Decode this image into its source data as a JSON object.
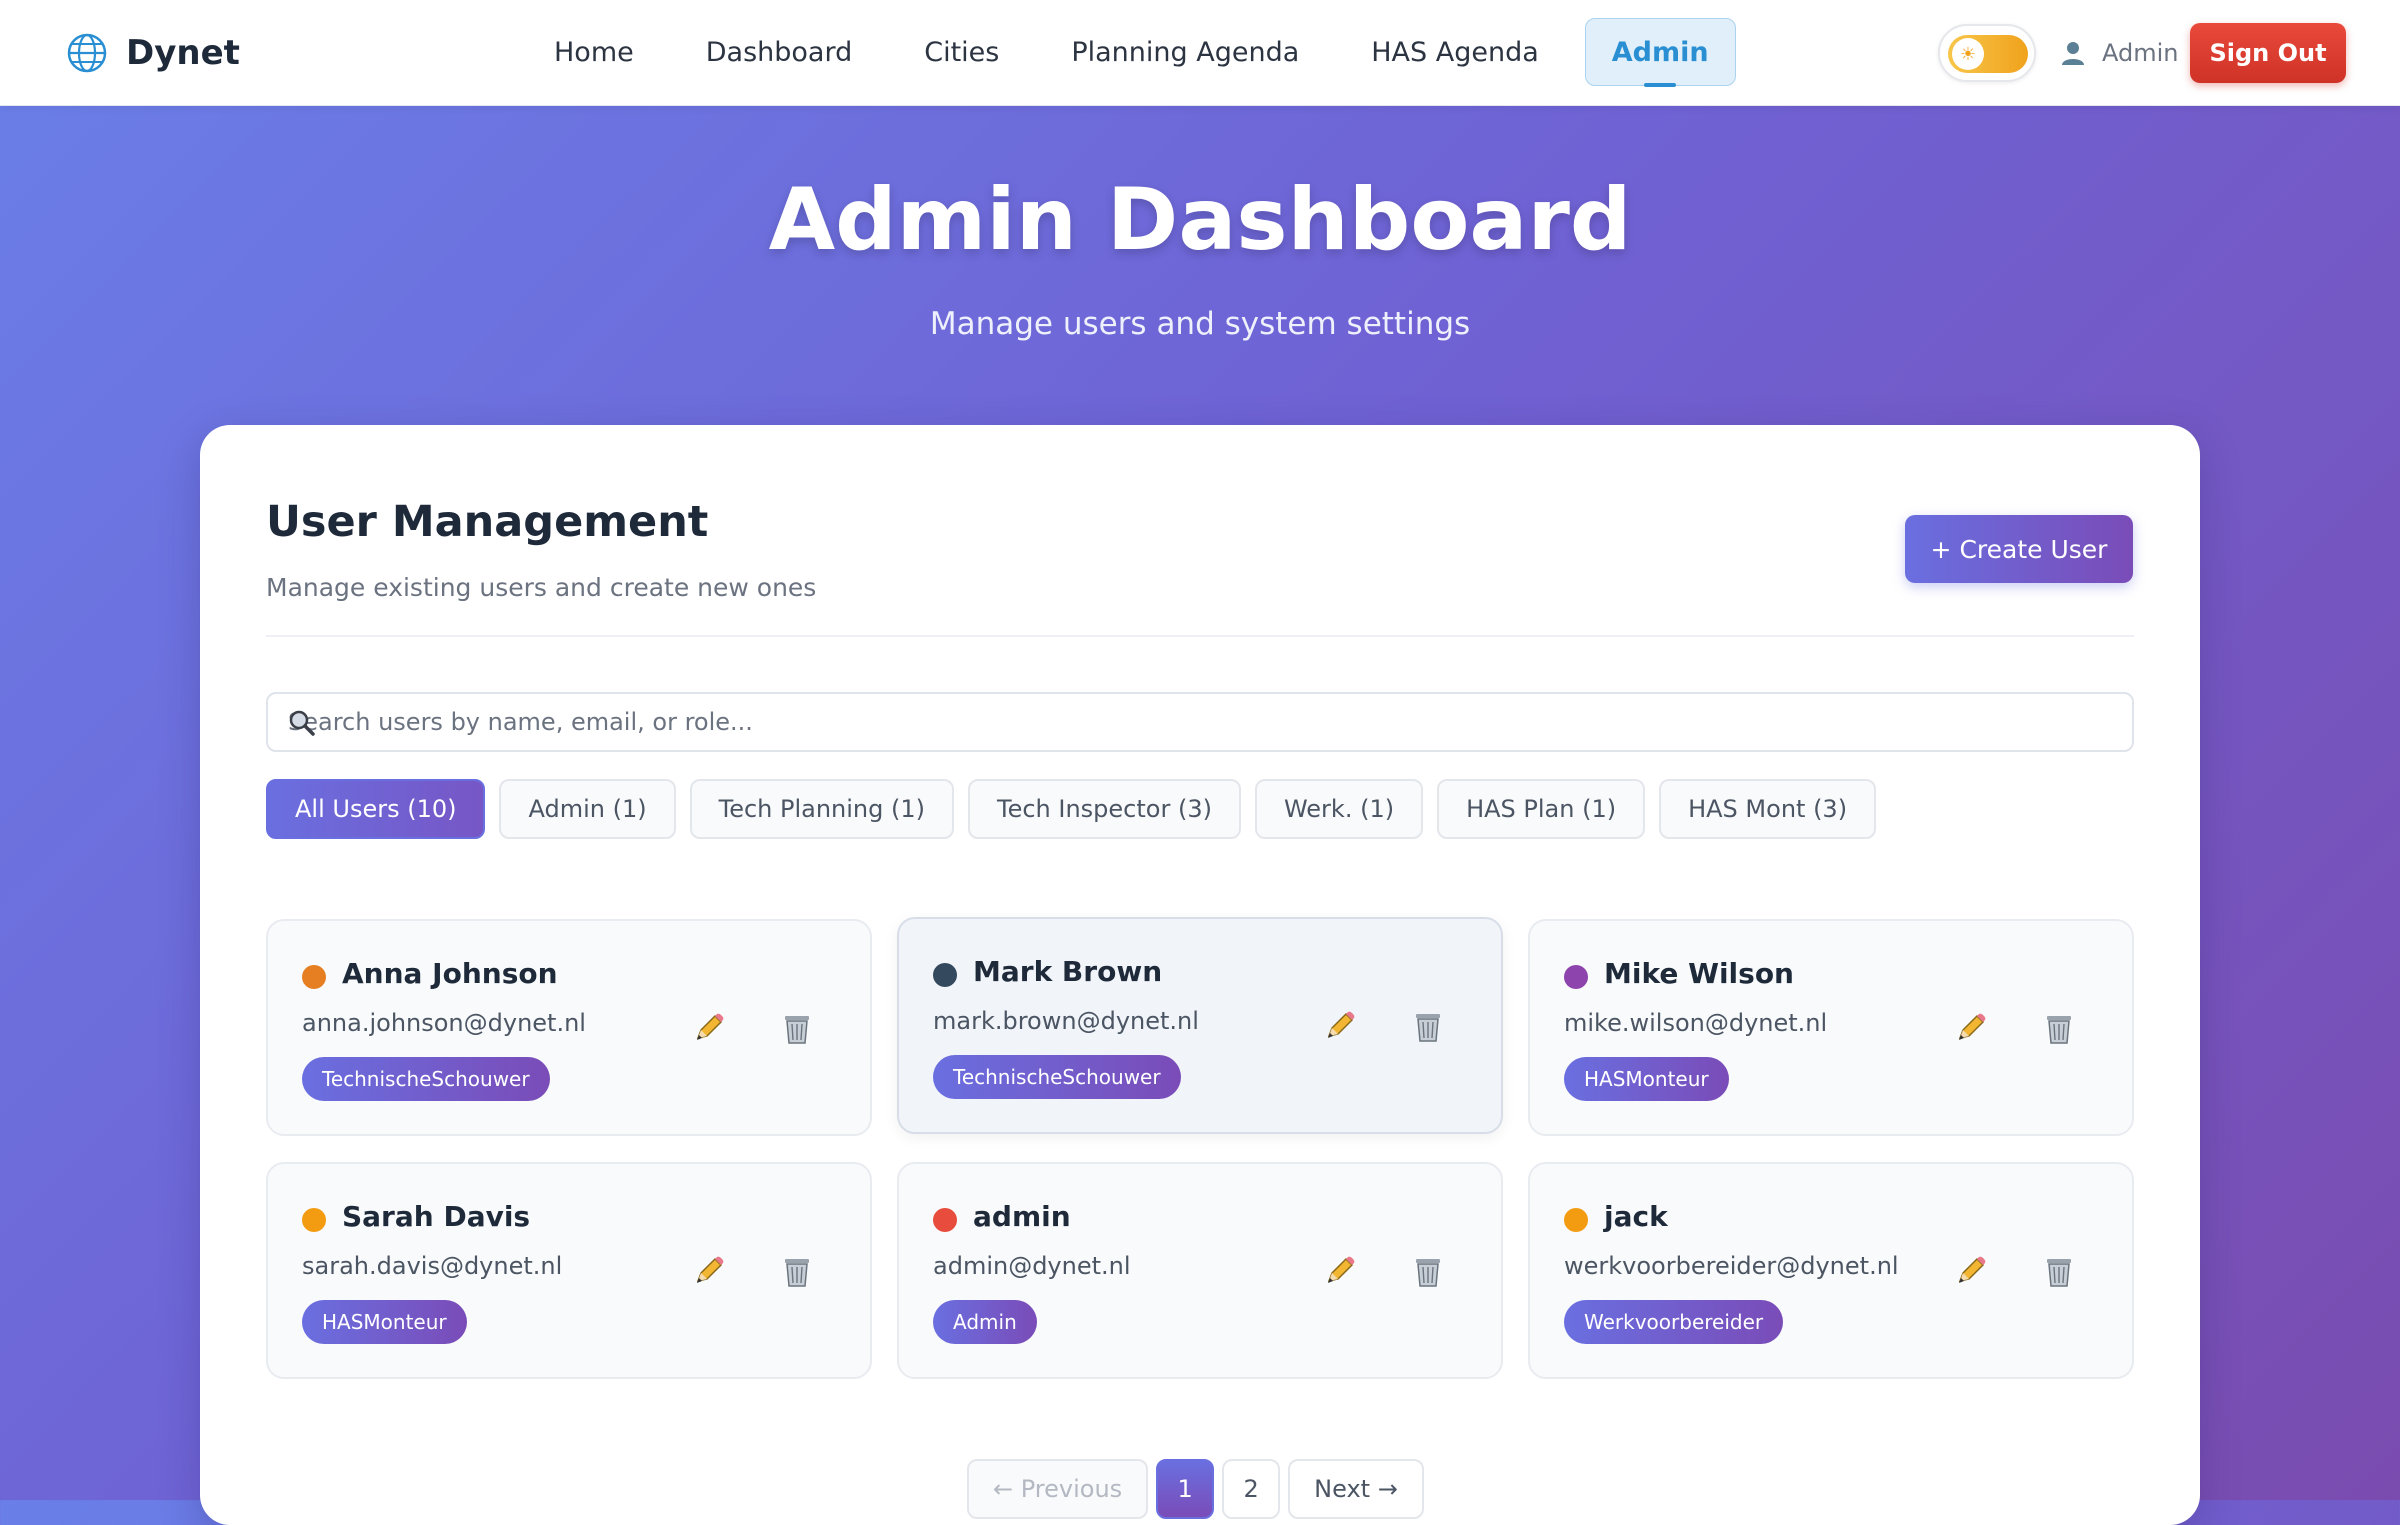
{
  "app": {
    "name": "Dynet"
  },
  "nav": {
    "links": [
      "Home",
      "Dashboard",
      "Cities",
      "Planning Agenda",
      "HAS Agenda"
    ],
    "active": "Admin"
  },
  "theme_toggle": {
    "icon": "sun-icon"
  },
  "user": {
    "name": "Admin",
    "icon": "user-icon"
  },
  "signout_label": "Sign Out",
  "hero": {
    "title": "Admin Dashboard",
    "subtitle": "Manage users and system settings"
  },
  "section": {
    "title": "User Management",
    "subtitle": "Manage existing users and create new ones",
    "create_label": "+ Create User"
  },
  "search": {
    "placeholder": "Search users by name, email, or role..."
  },
  "filters": [
    "All Users (10)",
    "Admin (1)",
    "Tech Planning (1)",
    "Tech Inspector (3)",
    "Werk. (1)",
    "HAS Plan (1)",
    "HAS Mont (3)"
  ],
  "users": [
    {
      "name": "Anna Johnson",
      "email": "anna.johnson@dynet.nl",
      "role": "TechnischeSchouwer",
      "dot_color": "#e67e22"
    },
    {
      "name": "Mark Brown",
      "email": "mark.brown@dynet.nl",
      "role": "TechnischeSchouwer",
      "dot_color": "#34495e"
    },
    {
      "name": "Mike Wilson",
      "email": "mike.wilson@dynet.nl",
      "role": "HASMonteur",
      "dot_color": "#8e44ad"
    },
    {
      "name": "Sarah Davis",
      "email": "sarah.davis@dynet.nl",
      "role": "HASMonteur",
      "dot_color": "#f39c12"
    },
    {
      "name": "admin",
      "email": "admin@dynet.nl",
      "role": "Admin",
      "dot_color": "#e74c3c"
    },
    {
      "name": "jack",
      "email": "werkvoorbereider@dynet.nl",
      "role": "Werkvoorbereider",
      "dot_color": "#f39c12"
    }
  ],
  "pagination": {
    "previous": "← Previous",
    "pages": [
      "1",
      "2"
    ],
    "next": "Next →"
  },
  "colors": {
    "accent": "#6a6fe0",
    "nav_active": "#2a8fd2",
    "signout": "#dc3b2e"
  }
}
